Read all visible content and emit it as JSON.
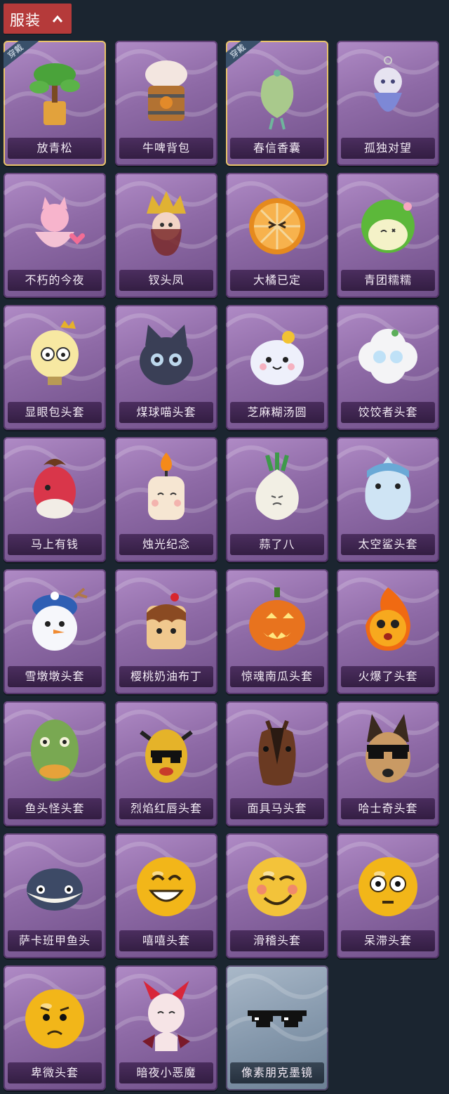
{
  "header": {
    "title": "服装",
    "toggle_icon": "chevron-up-icon",
    "bg": "#b53a3a"
  },
  "colors": {
    "background": "#1b2530",
    "card_purple": "#8e6aa6",
    "card_blue": "#8497ab",
    "equipped_border": "#e8c26a"
  },
  "items": [
    {
      "name": "放青松",
      "badge": "穿戴",
      "icon": "bonsai-tree-icon",
      "variant": "purple"
    },
    {
      "name": "牛啤背包",
      "badge": "",
      "icon": "beer-barrel-cow-icon",
      "variant": "purple"
    },
    {
      "name": "春信香囊",
      "badge": "穿戴",
      "icon": "sachet-pouch-icon",
      "variant": "purple"
    },
    {
      "name": "孤独对望",
      "badge": "",
      "icon": "doll-charm-icon",
      "variant": "purple"
    },
    {
      "name": "不朽的今夜",
      "badge": "",
      "icon": "fox-bowl-icon",
      "variant": "purple"
    },
    {
      "name": "钗头凤",
      "badge": "",
      "icon": "phoenix-crown-icon",
      "variant": "purple"
    },
    {
      "name": "大橘已定",
      "badge": "",
      "icon": "orange-slice-icon",
      "variant": "purple"
    },
    {
      "name": "青团糯糯",
      "badge": "",
      "icon": "green-dumpling-icon",
      "variant": "purple"
    },
    {
      "name": "显眼包头套",
      "badge": "",
      "icon": "lightbulb-head-icon",
      "variant": "purple"
    },
    {
      "name": "煤球喵头套",
      "badge": "",
      "icon": "black-cat-head-icon",
      "variant": "purple"
    },
    {
      "name": "芝麻糊汤圆",
      "badge": "",
      "icon": "rice-ball-icon",
      "variant": "purple"
    },
    {
      "name": "饺饺者头套",
      "badge": "",
      "icon": "cloud-head-icon",
      "variant": "purple"
    },
    {
      "name": "马上有钱",
      "badge": "",
      "icon": "red-horse-head-icon",
      "variant": "purple"
    },
    {
      "name": "烛光纪念",
      "badge": "",
      "icon": "candle-head-icon",
      "variant": "purple"
    },
    {
      "name": "蒜了八",
      "badge": "",
      "icon": "garlic-head-icon",
      "variant": "purple"
    },
    {
      "name": "太空鲨头套",
      "badge": "",
      "icon": "shark-head-icon",
      "variant": "purple"
    },
    {
      "name": "雪墩墩头套",
      "badge": "",
      "icon": "snowman-head-icon",
      "variant": "purple"
    },
    {
      "name": "樱桃奶油布丁",
      "badge": "",
      "icon": "pudding-head-icon",
      "variant": "purple"
    },
    {
      "name": "惊魂南瓜头套",
      "badge": "",
      "icon": "pumpkin-head-icon",
      "variant": "purple"
    },
    {
      "name": "火爆了头套",
      "badge": "",
      "icon": "fire-head-icon",
      "variant": "purple"
    },
    {
      "name": "鱼头怪头套",
      "badge": "",
      "icon": "fish-mask-icon",
      "variant": "purple"
    },
    {
      "name": "烈焰红唇头套",
      "badge": "",
      "icon": "yellow-mask-sunglasses-icon",
      "variant": "purple"
    },
    {
      "name": "面具马头套",
      "badge": "",
      "icon": "horse-mask-icon",
      "variant": "purple"
    },
    {
      "name": "哈士奇头套",
      "badge": "",
      "icon": "husky-head-icon",
      "variant": "purple"
    },
    {
      "name": "萨卡班甲鱼头",
      "badge": "",
      "icon": "fish-head-icon",
      "variant": "purple"
    },
    {
      "name": "嘻嘻头套",
      "badge": "",
      "icon": "grin-emoji-icon",
      "variant": "purple"
    },
    {
      "name": "滑稽头套",
      "badge": "",
      "icon": "smirk-emoji-icon",
      "variant": "purple"
    },
    {
      "name": "呆滞头套",
      "badge": "",
      "icon": "stare-emoji-icon",
      "variant": "purple"
    },
    {
      "name": "卑微头套",
      "badge": "",
      "icon": "shy-emoji-icon",
      "variant": "purple"
    },
    {
      "name": "暗夜小恶魔",
      "badge": "",
      "icon": "little-devil-icon",
      "variant": "purple"
    },
    {
      "name": "像素朋克墨镜",
      "badge": "",
      "icon": "pixel-sunglasses-icon",
      "variant": "blue"
    }
  ]
}
